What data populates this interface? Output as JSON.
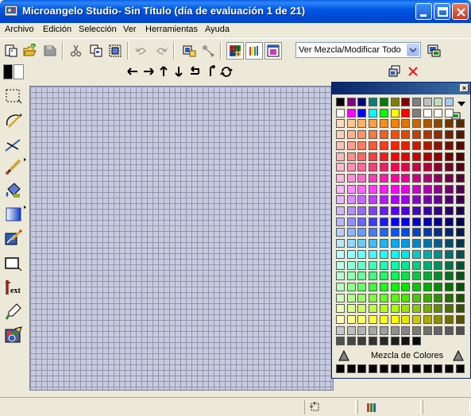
{
  "window": {
    "title": "Microangelo Studio- Sin Título (día de evaluación 1 de 21)"
  },
  "menu": {
    "items": [
      "Archivo",
      "Edición",
      "Selección",
      "Ver",
      "Herramientas",
      "Ayuda"
    ]
  },
  "toolbar": {
    "view_mode_value": "Ver Mezcla/Modificar Todo",
    "buttons": [
      "new-icon",
      "open-icon",
      "save-icon",
      "cut-icon",
      "copy-icon",
      "paste-icon",
      "undo-icon",
      "redo-icon",
      "zoom-icon",
      "eyedropper-icon",
      "grid-view-icon",
      "pencil-set-icon",
      "preview-window-icon",
      "display-icon"
    ]
  },
  "colors": {
    "foreground": "#000000",
    "background": "#FFFFFF",
    "canvas_bg": "#C6CBE0",
    "grid_line": "#8F95AE",
    "titlebar": "#0054E3"
  },
  "transform_tools": [
    "shift-left-icon",
    "shift-right-icon",
    "shift-up-icon",
    "shift-down-icon",
    "rotate-left-icon",
    "rotate-right-icon",
    "flip-icon"
  ],
  "tools": [
    "rectangle-select-icon",
    "lasso-icon",
    "line-icon",
    "brush-icon",
    "fill-icon",
    "gradient-icon",
    "replace-color-icon",
    "rectangle-icon",
    "text-icon",
    "eyedropper-icon",
    "recolor-icon"
  ],
  "palette": {
    "mix_label": "Mezcla de Colores",
    "top_row_1": [
      "#000000",
      "#800080",
      "#000080",
      "#008080",
      "#008000",
      "#808000",
      "#800000",
      "#808080",
      "#C0C0C0",
      "#C0DCC0",
      "#A6CAF0"
    ],
    "top_row_2": [
      "#FFFFFF",
      "#FF00FF",
      "#0000FF",
      "#00FFFF",
      "#00FF00",
      "#FFFF00",
      "#FF0000",
      "#808080",
      "#FFFFFF",
      "#FFFBF0",
      "#FFFFFF"
    ]
  }
}
